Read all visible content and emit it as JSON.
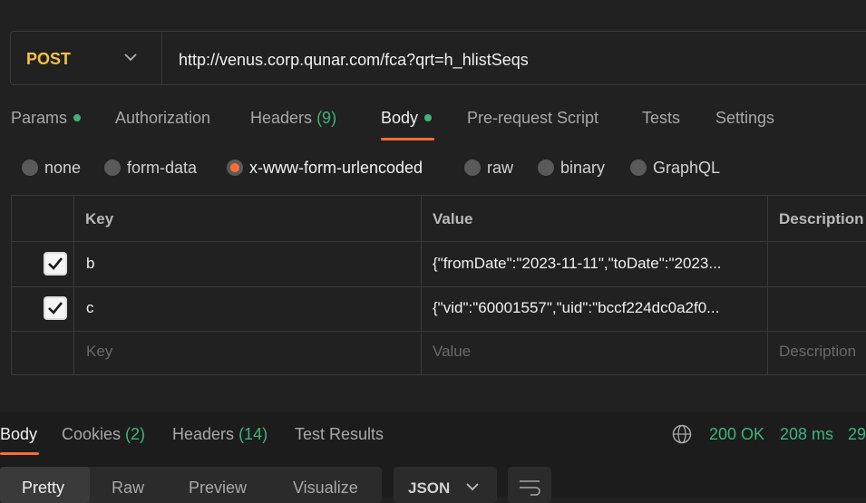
{
  "request": {
    "method": "POST",
    "url": "http://venus.corp.qunar.com/fca?qrt=h_hlistSeqs"
  },
  "tabs": {
    "params": "Params",
    "authorization": "Authorization",
    "headers": "Headers",
    "headers_count": "(9)",
    "body": "Body",
    "prerequest": "Pre-request Script",
    "tests": "Tests",
    "settings": "Settings"
  },
  "body_types": {
    "none": "none",
    "form_data": "form-data",
    "urlencoded": "x-www-form-urlencoded",
    "raw": "raw",
    "binary": "binary",
    "graphql": "GraphQL",
    "selected": "x-www-form-urlencoded"
  },
  "table": {
    "headers": {
      "key": "Key",
      "value": "Value",
      "description": "Description"
    },
    "rows": [
      {
        "checked": true,
        "key": "b",
        "value": "{\"fromDate\":\"2023-11-11\",\"toDate\":\"2023..."
      },
      {
        "checked": true,
        "key": "c",
        "value": "{\"vid\":\"60001557\",\"uid\":\"bccf224dc0a2f0..."
      }
    ],
    "placeholder": {
      "key": "Key",
      "value": "Value",
      "description": "Description"
    }
  },
  "response": {
    "tabs": {
      "body": "Body",
      "cookies": "Cookies",
      "cookies_count": "(2)",
      "headers": "Headers",
      "headers_count": "(14)",
      "test_results": "Test Results"
    },
    "status": "200 OK",
    "time": "208 ms",
    "size": "29",
    "views": {
      "pretty": "Pretty",
      "raw": "Raw",
      "preview": "Preview",
      "visualize": "Visualize"
    },
    "format": "JSON"
  },
  "colors": {
    "accent": "#ff6c37",
    "method": "#f5c243",
    "success": "#3fb37f",
    "background": "#212121"
  }
}
